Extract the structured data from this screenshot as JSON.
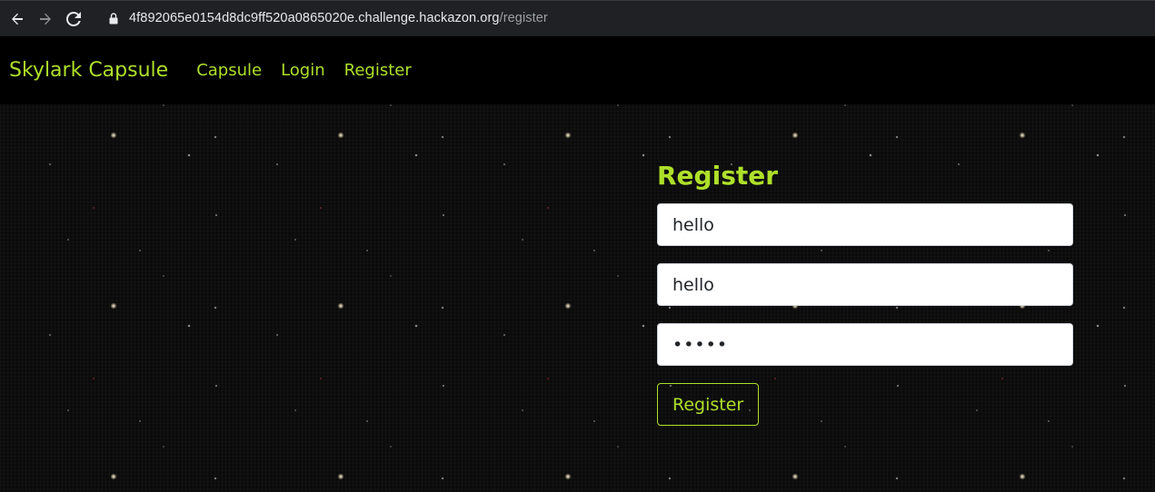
{
  "browser": {
    "url_host": "4f892065e0154d8dc9ff520a0865020e.challenge.hackazon.org",
    "url_path": "/register"
  },
  "navbar": {
    "brand": "Skylark Capsule",
    "links": [
      {
        "label": "Capsule"
      },
      {
        "label": "Login"
      },
      {
        "label": "Register"
      }
    ]
  },
  "form": {
    "title": "Register",
    "username_value": "hello",
    "email_value": "hello",
    "password_value": "•••••",
    "submit_label": "Register"
  },
  "colors": {
    "accent": "#aee02a",
    "navbar_bg": "#000000",
    "page_bg": "#0b0b0b"
  },
  "icons": [
    "back-arrow-icon",
    "forward-arrow-icon",
    "reload-icon",
    "lock-icon"
  ]
}
